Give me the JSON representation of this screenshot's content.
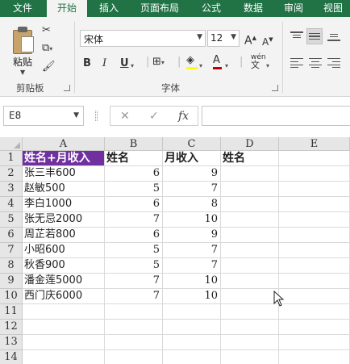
{
  "ribbon_tabs": [
    {
      "label": "文件",
      "active": false
    },
    {
      "label": "开始",
      "active": true
    },
    {
      "label": "插入",
      "active": false
    },
    {
      "label": "页面布局",
      "active": false
    },
    {
      "label": "公式",
      "active": false
    },
    {
      "label": "数据",
      "active": false
    },
    {
      "label": "审阅",
      "active": false
    },
    {
      "label": "视图",
      "active": false
    }
  ],
  "clipboard": {
    "group_label": "剪贴板",
    "paste_label": "粘贴"
  },
  "font": {
    "group_label": "字体",
    "font_name": "宋体",
    "font_size": "12",
    "bold": "B",
    "italic": "I",
    "underline": "U",
    "grow": "A",
    "shrink": "A",
    "font_color_glyph": "A",
    "phonetic": "wén"
  },
  "formula_bar": {
    "name_box": "E8",
    "cancel": "✕",
    "enter": "✓",
    "fx": "fx",
    "formula": ""
  },
  "columns": [
    "A",
    "B",
    "C",
    "D",
    "E"
  ],
  "rows": [
    "1",
    "2",
    "3",
    "4",
    "5",
    "6",
    "7",
    "8",
    "9",
    "10",
    "11",
    "12",
    "13",
    "14"
  ],
  "sheet": {
    "header": [
      "姓名+月收入",
      "姓名",
      "月收入",
      "姓名"
    ],
    "data": [
      {
        "a": "张三丰600",
        "b": "6",
        "c": "9"
      },
      {
        "a": "赵敏500",
        "b": "5",
        "c": "7"
      },
      {
        "a": "李白1000",
        "b": "6",
        "c": "8"
      },
      {
        "a": "张无忌2000",
        "b": "7",
        "c": "10"
      },
      {
        "a": "周芷若800",
        "b": "6",
        "c": "9"
      },
      {
        "a": "小昭600",
        "b": "5",
        "c": "7"
      },
      {
        "a": "秋香900",
        "b": "5",
        "c": "7"
      },
      {
        "a": "潘金莲5000",
        "b": "7",
        "c": "10"
      },
      {
        "a": "西门庆6000",
        "b": "7",
        "c": "10"
      }
    ]
  },
  "colors": {
    "brand": "#217346",
    "highlight": "#7030a0",
    "font_color_bar": "#c00000",
    "fill_bar": "#ffff00"
  }
}
